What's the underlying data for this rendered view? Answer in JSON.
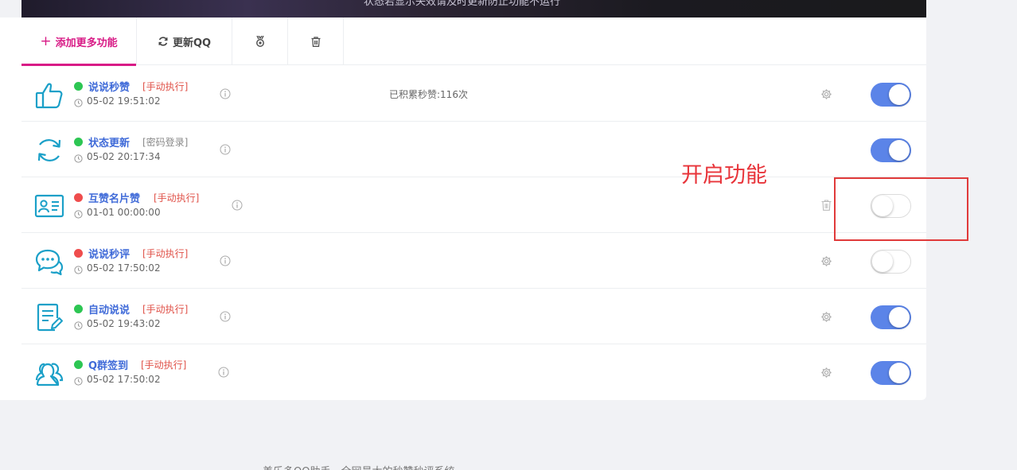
{
  "banner": {
    "text": "状态若显示失效请及时更新防止功能不运行"
  },
  "tabs": {
    "add_label": "添加更多功能",
    "refresh_label": "更新QQ"
  },
  "colors": {
    "accent": "#d81b86",
    "link": "#3f6ad8",
    "toggle_on": "#5b84e8",
    "status_green": "#2dc653",
    "status_red": "#ef4d4d",
    "icon_teal": "#1ba0c8"
  },
  "tasks": [
    {
      "name": "说说秒赞",
      "tag": "[手动执行]",
      "tag_style": "red",
      "status": "green",
      "time": "05-02 19:51:02",
      "stat": "已积累秒赞:116次",
      "action_icon": "gear-icon",
      "enabled": true,
      "icon": "thumbs-up-icon"
    },
    {
      "name": "状态更新",
      "tag": "[密码登录]",
      "tag_style": "gray",
      "status": "green",
      "time": "05-02 20:17:34",
      "stat": "",
      "action_icon": "",
      "enabled": true,
      "icon": "refresh-cycle-icon"
    },
    {
      "name": "互赞名片赞",
      "tag": "[手动执行]",
      "tag_style": "red",
      "status": "red",
      "time": "01-01 00:00:00",
      "stat": "",
      "action_icon": "trash-icon",
      "enabled": false,
      "icon": "id-card-icon"
    },
    {
      "name": "说说秒评",
      "tag": "[手动执行]",
      "tag_style": "red",
      "status": "red",
      "time": "05-02 17:50:02",
      "stat": "",
      "action_icon": "gear-icon",
      "enabled": false,
      "icon": "chat-bubbles-icon"
    },
    {
      "name": "自动说说",
      "tag": "[手动执行]",
      "tag_style": "red",
      "status": "green",
      "time": "05-02 19:43:02",
      "stat": "",
      "action_icon": "gear-icon",
      "enabled": true,
      "icon": "edit-document-icon"
    },
    {
      "name": "Q群签到",
      "tag": "[手动执行]",
      "tag_style": "red",
      "status": "green",
      "time": "05-02 17:50:02",
      "stat": "",
      "action_icon": "gear-icon",
      "enabled": true,
      "icon": "group-users-icon"
    }
  ],
  "annotation": {
    "label": "开启功能"
  },
  "footer": {
    "text": "美乐多QQ助手，全网最大的秒赞秒评系统"
  }
}
